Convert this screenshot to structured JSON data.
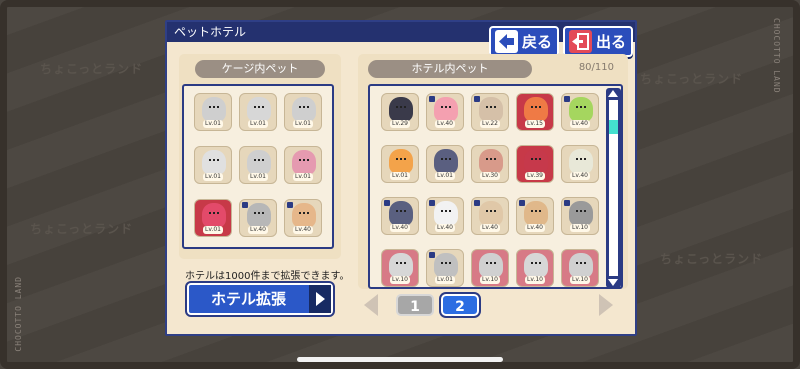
{
  "window_title": "ペットホテル",
  "buttons": {
    "back": "戻る",
    "exit": "出る",
    "expand": "ホテル拡張"
  },
  "cage": {
    "header": "ケージ内ペット",
    "pets": [
      {
        "level": "Lv.01",
        "color": "#cfcfcf"
      },
      {
        "level": "Lv.01",
        "color": "#d7d7d7"
      },
      {
        "level": "Lv.01",
        "color": "#cfcfcf"
      },
      {
        "level": "Lv.01",
        "color": "#e0e0e0"
      },
      {
        "level": "Lv.01",
        "color": "#cfcfcf"
      },
      {
        "level": "Lv.01",
        "color": "#e59ab0"
      },
      {
        "level": "Lv.01",
        "color": "#e34a6a",
        "bg": "red"
      },
      {
        "level": "Lv.40",
        "color": "#b7b7b7",
        "locked": true
      },
      {
        "level": "Lv.40",
        "color": "#e6b78a",
        "locked": true
      }
    ]
  },
  "hotel": {
    "header": "ホテル内ペット",
    "count": "80/110",
    "pets": [
      {
        "level": "Lv.29",
        "color": "#3a3a4a"
      },
      {
        "level": "Lv.40",
        "color": "#f4a0b0",
        "locked": true
      },
      {
        "level": "Lv.22",
        "color": "#d5c0a8",
        "locked": true
      },
      {
        "level": "Lv.15",
        "color": "#ef7a45",
        "bg": "red"
      },
      {
        "level": "Lv.40",
        "color": "#a5d65f",
        "locked": true
      },
      {
        "level": "Lv.01",
        "color": "#f3a34a"
      },
      {
        "level": "Lv.01",
        "color": "#5a5f80"
      },
      {
        "level": "Lv.30",
        "color": "#d89a8a"
      },
      {
        "level": "Lv.39",
        "color": "#c6394b",
        "bg": "red"
      },
      {
        "level": "Lv.40",
        "color": "#e8e8d8"
      },
      {
        "level": "Lv.40",
        "color": "#5a6080",
        "locked": true
      },
      {
        "level": "Lv.40",
        "color": "#f2f2f2",
        "locked": true
      },
      {
        "level": "Lv.40",
        "color": "#e0c8a8",
        "locked": true
      },
      {
        "level": "Lv.40",
        "color": "#e0b88a",
        "locked": true
      },
      {
        "level": "Lv.10",
        "color": "#9a9a9a",
        "locked": true
      },
      {
        "level": "Lv.10",
        "color": "#d7d7d7",
        "bg": "redlt"
      },
      {
        "level": "Lv.01",
        "color": "#c0c0c0",
        "locked": true
      },
      {
        "level": "Lv.10",
        "color": "#d0d0d0",
        "bg": "redlt"
      },
      {
        "level": "Lv.10",
        "color": "#d7d7d7",
        "bg": "redlt"
      },
      {
        "level": "Lv.10",
        "color": "#d0d0d0",
        "bg": "redlt"
      }
    ]
  },
  "expand_note": "ホテルは1000件まで拡張できます。",
  "pages": [
    "1",
    "2"
  ],
  "current_page": "2",
  "side_label_left": "CHOCOTTO LAND",
  "side_label_right": "CHOCOTTO LAND",
  "watermark": "ちょこっとランド"
}
